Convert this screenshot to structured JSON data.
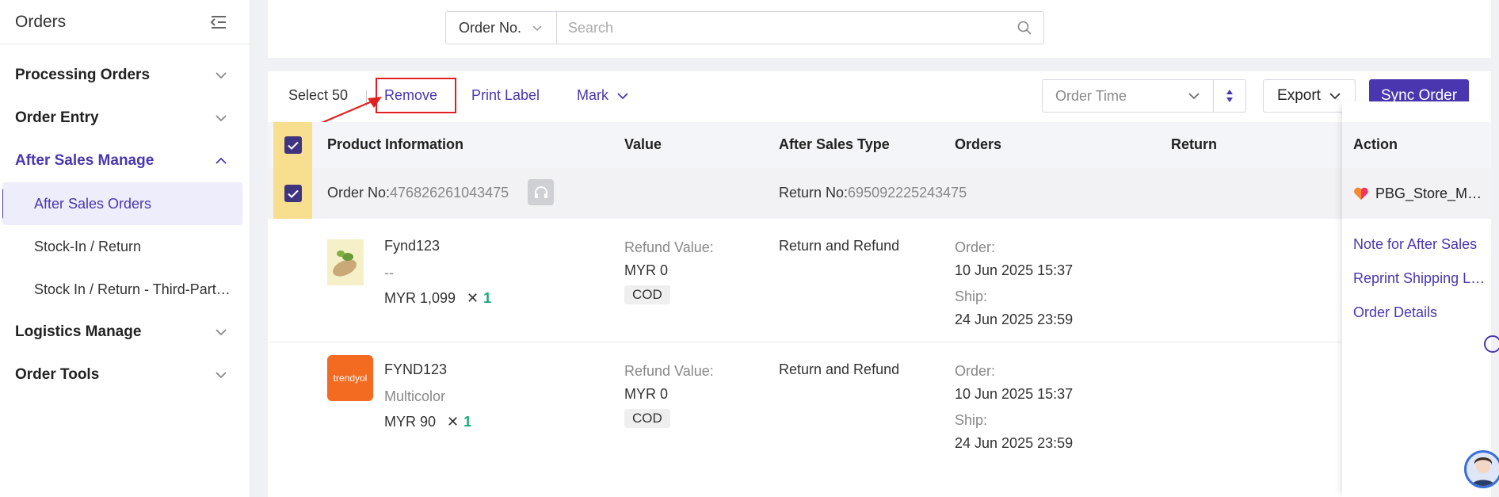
{
  "sidebar": {
    "title": "Orders",
    "groups": [
      {
        "label": "Processing Orders"
      },
      {
        "label": "Order Entry"
      },
      {
        "label": "After Sales Manage"
      },
      {
        "label": "Logistics Manage"
      },
      {
        "label": "Order Tools"
      }
    ],
    "sub_items": [
      {
        "label": "After Sales Orders"
      },
      {
        "label": "Stock-In / Return"
      },
      {
        "label": "Stock In / Return - Third-Party Warehouse"
      }
    ]
  },
  "search": {
    "type": "Order No.",
    "placeholder": "Search"
  },
  "toolbar": {
    "select_label": "Select 50",
    "remove_label": "Remove",
    "print_label": "Print Label",
    "mark_label": "Mark",
    "sort_label": "Order Time",
    "export_label": "Export",
    "sync_label": "Sync Order"
  },
  "table": {
    "headers": {
      "product": "Product Information",
      "value": "Value",
      "after_sales_type": "After Sales Type",
      "orders": "Orders",
      "return": "Return",
      "action": "Action"
    },
    "order": {
      "order_no_label": "Order No:",
      "order_no": "476826261043475",
      "return_no_label": "Return No:",
      "return_no": "695092225243475",
      "store": "PBG_Store_Malaysia"
    },
    "items": [
      {
        "name": "Fynd123",
        "variant": "--",
        "price": "MYR 1,099",
        "qty": "1",
        "refund_label": "Refund Value:",
        "refund_value": "MYR 0",
        "payment": "COD",
        "type": "Return and Refund",
        "order_label": "Order:",
        "order_time": "10 Jun 2025 15:37",
        "ship_label": "Ship:",
        "ship_time": "24 Jun 2025 23:59"
      },
      {
        "name": "FYND123",
        "variant": "Multicolor",
        "logo_text": "trendyol",
        "price": "MYR 90",
        "qty": "1",
        "refund_label": "Refund Value:",
        "refund_value": "MYR 0",
        "payment": "COD",
        "type": "Return and Refund",
        "order_label": "Order:",
        "order_time": "10 Jun 2025 15:37",
        "ship_label": "Ship:",
        "ship_time": "24 Jun 2025 23:59"
      }
    ],
    "actions": [
      {
        "label": "Note for After Sales"
      },
      {
        "label": "Reprint Shipping Label"
      },
      {
        "label": "Order Details"
      }
    ]
  },
  "colors": {
    "accent": "#4a37b0",
    "highlight_checkbox_bg": "#f7df8f",
    "qty_green": "#19a97b",
    "annotation_red": "#e02020"
  }
}
